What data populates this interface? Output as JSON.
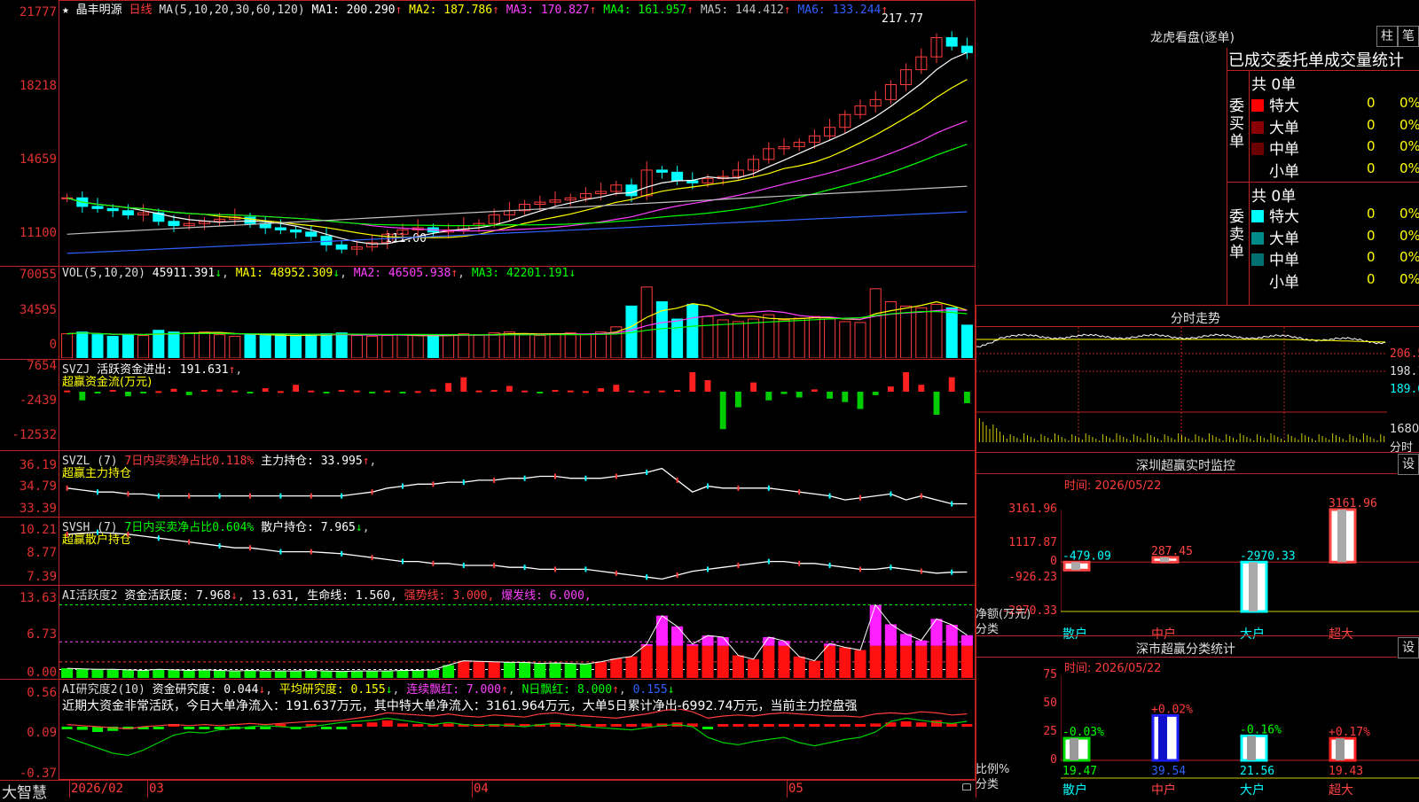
{
  "header": {
    "star": "★",
    "stock_name": "晶丰明源",
    "period": "日线",
    "ma_title": "MA(5,10,20,30,60,120)",
    "ma": [
      {
        "label": "MA1: 200.290",
        "arrow": "↑",
        "color": "#ffffff"
      },
      {
        "label": "MA2: 187.786",
        "arrow": "↑",
        "color": "#ffff00"
      },
      {
        "label": "MA3: 170.827",
        "arrow": "↑",
        "color": "#ff40ff"
      },
      {
        "label": "MA4: 161.957",
        "arrow": "↑",
        "color": "#00ff00"
      },
      {
        "label": "MA5: 144.412",
        "arrow": "↑",
        "color": "#c0c0c0"
      },
      {
        "label": "MA6: 133.244",
        "arrow": "↑",
        "color": "#3060ff"
      }
    ]
  },
  "price_axis": [
    "21777",
    "18218",
    "14659",
    "11100"
  ],
  "price_marks": {
    "high": "217.77",
    "low": "111.00"
  },
  "vol_panel": {
    "title": "VOL(5,10,20)",
    "value": "45911.391",
    "ma1": "MA1: 48952.309",
    "ma2": "MA2: 46505.938",
    "ma3": "MA3: 42201.191",
    "axis": [
      "70055",
      "34595",
      "0"
    ]
  },
  "svzj_panel": {
    "title": "SVZJ",
    "label": "活跃资金进出: 191.631",
    "subtitle": "超赢资金流(万元)",
    "axis": [
      "7654",
      "-2439",
      "-12532"
    ]
  },
  "svzl_panel": {
    "title": "SVZL (7)",
    "label1": "7日内买卖净占比0.118%",
    "label2": "主力持仓: 33.995",
    "subtitle": "超赢主力持仓",
    "axis": [
      "36.19",
      "34.79",
      "33.39"
    ]
  },
  "svsh_panel": {
    "title": "SVSH (7)",
    "label1": "7日内买卖净占比0.604%",
    "label2": "散户持仓: 7.965",
    "subtitle": "超赢散户持仓",
    "axis": [
      "10.21",
      "8.77",
      "7.39"
    ]
  },
  "ai_active_panel": {
    "title": "AI活跃度2",
    "label1": "资金活跃度: 7.968",
    "label2": "13.631,",
    "label3": "生命线: 1.560,",
    "label4": "强势线: 3.000,",
    "label5": "爆发线: 6.000,",
    "axis": [
      "13.63",
      "6.73",
      "0.00"
    ]
  },
  "ai_research_panel": {
    "title": "AI研究度2(10)",
    "label1": "资金研究度: 0.044",
    "label2": "平均研究度: 0.155",
    "label3": "连续飘红: 7.000",
    "label4": "N日飘红: 8.000",
    "label5": "0.155",
    "comment": "近期大资金非常活跃，今日大单净流入：191.637万元，其中特大单净流入：3161.964万元，大单5日累计净出-6992.74万元，当前主力控盘强",
    "axis": [
      "0.56",
      "0.09",
      "-0.37"
    ]
  },
  "date_axis": {
    "brand": "大智慧",
    "labels": [
      "2026/02",
      "03",
      "04",
      "05"
    ]
  },
  "right_panel": {
    "lhb_title": "龙虎看盘(逐单)",
    "tab1": "柱",
    "tab2": "笔",
    "stat_title": "已成交委托单成交量统计",
    "buy_group": "委买单",
    "sell_group": "委卖单",
    "buy_total": "共 0单",
    "sell_total": "共 0单",
    "buy_rows": [
      {
        "label": "特大",
        "count": "0",
        "pct": "0%",
        "color": "#ff0000"
      },
      {
        "label": "大单",
        "count": "0",
        "pct": "0%",
        "color": "#8b0000"
      },
      {
        "label": "中单",
        "count": "0",
        "pct": "0%",
        "color": "#6a0000"
      },
      {
        "label": "小单",
        "count": "0",
        "pct": "0%",
        "color": ""
      }
    ],
    "sell_rows": [
      {
        "label": "特大",
        "count": "0",
        "pct": "0%",
        "color": "#00ffff"
      },
      {
        "label": "大单",
        "count": "0",
        "pct": "0%",
        "color": "#008b8b"
      },
      {
        "label": "中单",
        "count": "0",
        "pct": "0%",
        "color": "#007070"
      },
      {
        "label": "小单",
        "count": "0",
        "pct": "0%",
        "color": ""
      }
    ],
    "intraday_title": "分时走势",
    "intraday_axis": [
      "206.5",
      "198.1",
      "189.6"
    ],
    "intraday_vol_label": "1680",
    "intraday_unit": "分时",
    "sz_monitor": {
      "title": "深圳超赢实时监控",
      "set": "设",
      "time": "时间: 2026/05/22",
      "axis": [
        "3161.96",
        "1117.87",
        "0",
        "-926.23",
        "-2970.33"
      ],
      "ylabel": "净额(万元)",
      "xlabel": "分类",
      "categories": [
        "散户",
        "中户",
        "大户",
        "超大"
      ],
      "values": [
        -479.09,
        287.45,
        -2970.33,
        3161.96
      ],
      "value_labels": [
        "-479.09",
        "287.45",
        "-2970.33",
        "3161.96"
      ]
    },
    "sz_classify": {
      "title": "深市超赢分类统计",
      "set": "设",
      "time": "时间: 2026/05/22",
      "axis": [
        "75",
        "50",
        "25",
        "0"
      ],
      "ylabel": "比例%",
      "xlabel": "分类",
      "categories": [
        "散户",
        "中户",
        "大户",
        "超大"
      ],
      "values": [
        19.47,
        39.54,
        21.56,
        19.43
      ],
      "value_labels": [
        "19.47",
        "39.54",
        "21.56",
        "19.43"
      ],
      "changes": [
        "-0.03%",
        "+0.02%",
        "-0.16%",
        "+0.17%"
      ]
    }
  },
  "chart_data": [
    {
      "type": "bar",
      "title": "深圳超赢实时监控",
      "categories": [
        "散户",
        "中户",
        "大户",
        "超大"
      ],
      "values": [
        -479.09,
        287.45,
        -2970.33,
        3161.96
      ],
      "ylabel": "净额(万元)",
      "xlabel": "分类",
      "ylim": [
        -2970.33,
        3161.96
      ]
    },
    {
      "type": "bar",
      "title": "深市超赢分类统计",
      "categories": [
        "散户",
        "中户",
        "大户",
        "超大"
      ],
      "values": [
        19.47,
        39.54,
        21.56,
        19.43
      ],
      "ylabel": "比例%",
      "xlabel": "分类",
      "ylim": [
        0,
        75
      ]
    }
  ]
}
